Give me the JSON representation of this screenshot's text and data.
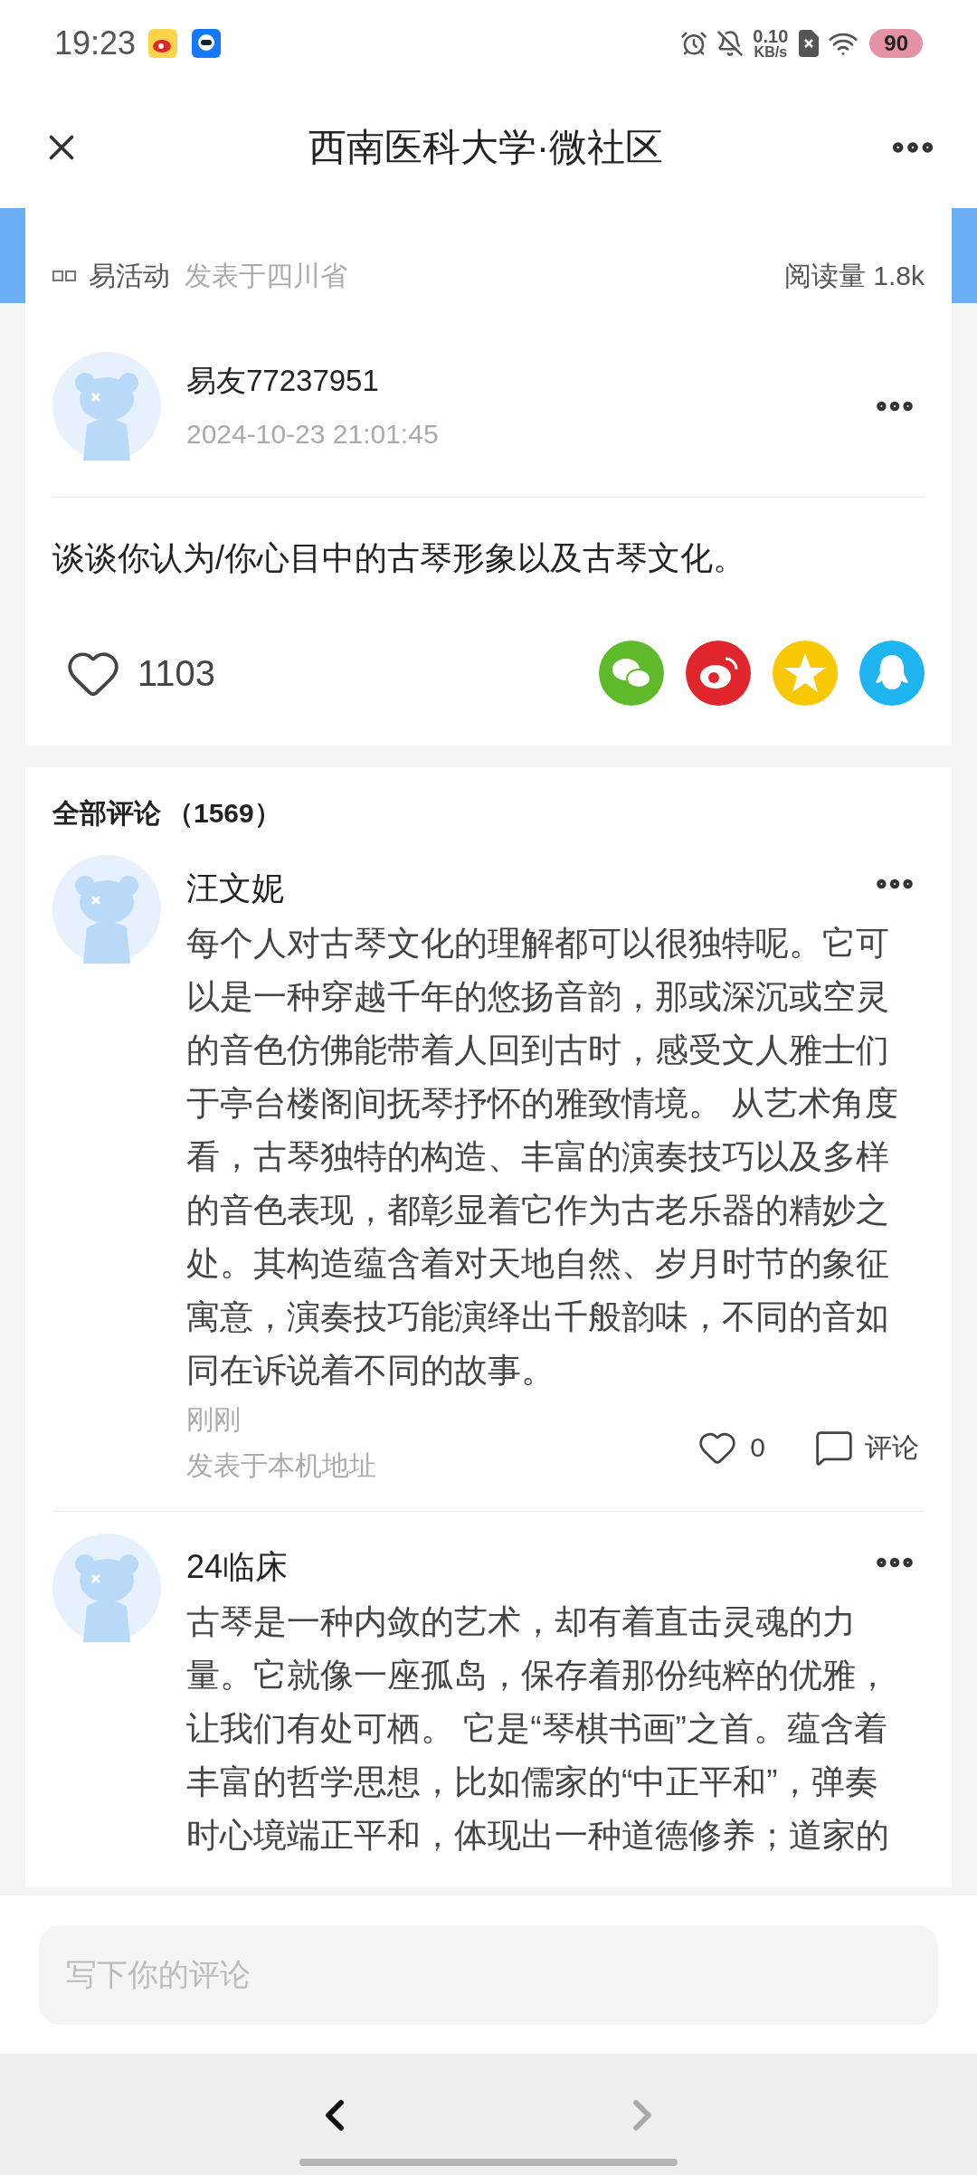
{
  "status_bar": {
    "time": "19:23",
    "net_speed": "0.10",
    "net_unit": "KB/s",
    "battery": "90"
  },
  "header": {
    "title": "西南医科大学·微社区"
  },
  "post": {
    "source": "易活动",
    "location": "发表于四川省",
    "reads": "阅读量 1.8k",
    "author": "易友77237951",
    "date": "2024-10-23 21:01:45",
    "body": "谈谈你认为/你心目中的古琴形象以及古琴文化。",
    "likes": "1103",
    "liked": false
  },
  "comments_section": {
    "title": "全部评论",
    "count": "（1569）"
  },
  "comments": [
    {
      "name": "汪文妮",
      "text": "每个人对古琴文化的理解都可以很独特呢。它可以是一种穿越千年的悠扬音韵，那或深沉或空灵的音色仿佛能带着人回到古时，感受文人雅士们于亭台楼阁间抚琴抒怀的雅致情境。 从艺术角度看，古琴独特的构造、丰富的演奏技巧以及多样的音色表现，都彰显着它作为古老乐器的精妙之处。其构造蕴含着对天地自然、岁月时节的象征寓意，演奏技巧能演绎出千般韵味，不同的音如同在诉说着不同的故事。",
      "time": "刚刚",
      "location": "发表于本机地址",
      "likes": "0",
      "liked": false,
      "reply_label": "评论"
    },
    {
      "name": "24临床",
      "text": "古琴是一种内敛的艺术，却有着直击灵魂的力量。它就像一座孤岛，保存着那份纯粹的优雅，让我们有处可栖。 它是“琴棋书画”之首。蕴含着丰富的哲学思想，比如儒家的“中正平和”，弹奏时心境端正平和，体现出一种道德修养；道家的"
    }
  ],
  "comment_input": {
    "placeholder": "写下你的评论"
  },
  "nav": {
    "back_disabled": false,
    "forward_disabled": true
  }
}
